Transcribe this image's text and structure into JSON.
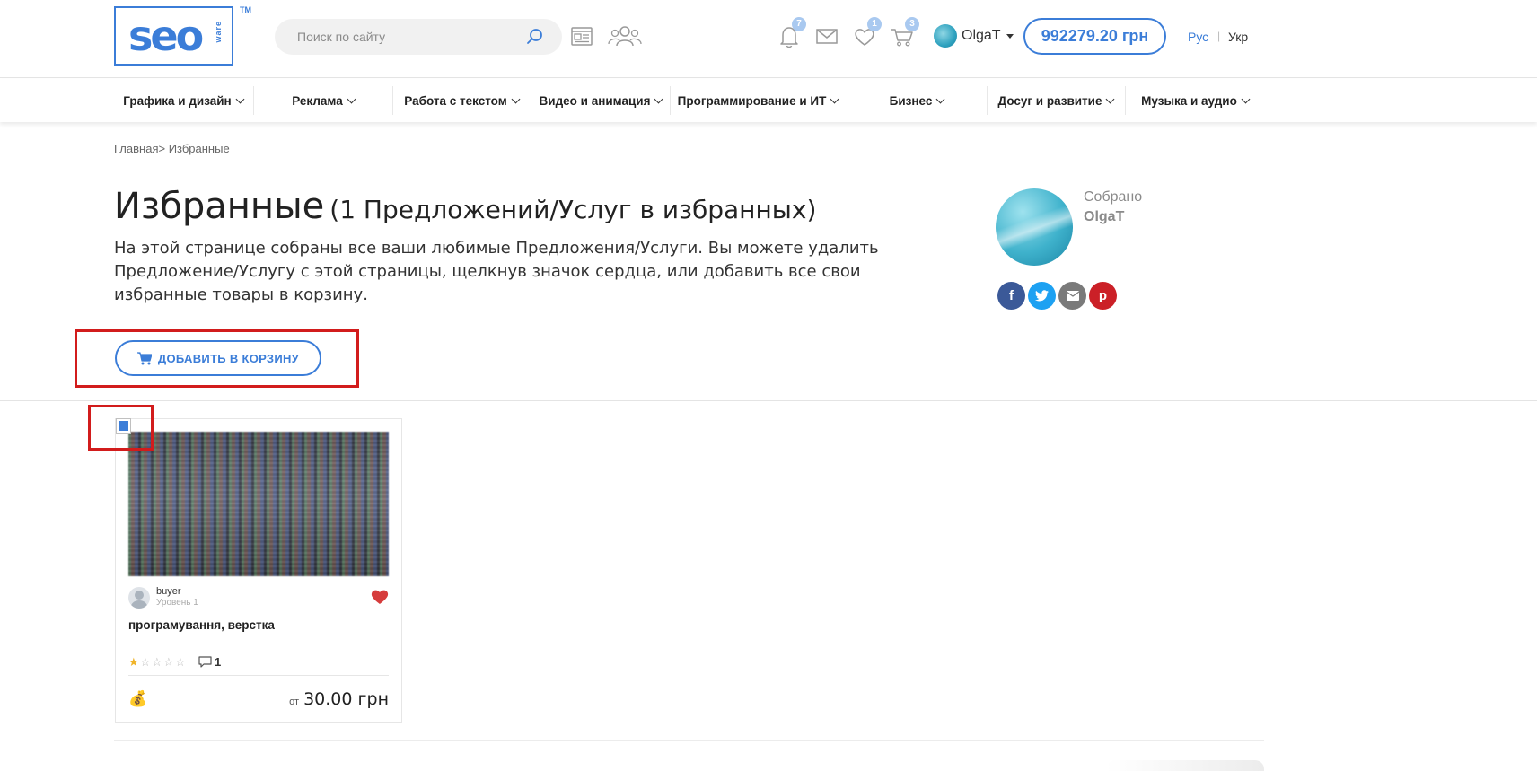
{
  "header": {
    "logo": {
      "word": "seo",
      "sub": "ware",
      "tm": "TM"
    },
    "search": {
      "placeholder": "Поиск по сайту",
      "icon": "search-icon"
    },
    "icons": [
      {
        "name": "news-icon",
        "badge": null
      },
      {
        "name": "users-icon",
        "badge": null
      },
      {
        "name": "bell-icon",
        "badge": "7"
      },
      {
        "name": "mail-icon",
        "badge": null
      },
      {
        "name": "heart-icon",
        "badge": "1"
      },
      {
        "name": "cart-icon",
        "badge": "3"
      }
    ],
    "user": {
      "name": "OlgaT"
    },
    "balance": "992279.20 грн",
    "languages": {
      "ru": "Рус",
      "separator": "|",
      "uk": "Укр"
    }
  },
  "categories": [
    {
      "label": "Графика и дизайн"
    },
    {
      "label": "Реклама"
    },
    {
      "label": "Работа с текстом"
    },
    {
      "label": "Видео и анимация"
    },
    {
      "label": "Программирование и ИТ"
    },
    {
      "label": "Бизнес"
    },
    {
      "label": "Досуг и развитие"
    },
    {
      "label": "Музыка и аудио"
    }
  ],
  "breadcrumb": {
    "home": "Главная",
    "separator": ">",
    "current": " Избранные"
  },
  "page": {
    "title": "Избранные",
    "subtitle": "(1 Предложений/Услуг в избранных)",
    "description": "На этой странице собраны все ваши любимые Предложения/Услуги. Вы можете удалить Предложение/Услугу с этой страницы, щелкнув значок сердца, или добавить все свои избранные товары в корзину.",
    "add_to_cart": "ДОБАВИТЬ В КОРЗИНУ"
  },
  "collector": {
    "label": "Собрано",
    "name": "OlgaT",
    "social": [
      {
        "name": "facebook-icon",
        "glyph": "f",
        "color": "#3b5998"
      },
      {
        "name": "twitter-icon",
        "glyph": "t",
        "color": "#1da1f2"
      },
      {
        "name": "email-icon",
        "glyph": "✉",
        "color": "#7a7a7a"
      },
      {
        "name": "pinterest-icon",
        "glyph": "p",
        "color": "#cb2027"
      }
    ]
  },
  "products": [
    {
      "selected": true,
      "seller": "buyer",
      "level": "Уровень 1",
      "title": "програмування, верстка",
      "rating": 1,
      "rating_max": 5,
      "comments": "1",
      "price_prefix": "от",
      "price": "30.00 грн",
      "favorited": true
    }
  ],
  "colors": {
    "accent": "#3b7dd8",
    "highlight": "#d21c1c",
    "heart": "#d63c3c",
    "star": "#f0b429"
  }
}
